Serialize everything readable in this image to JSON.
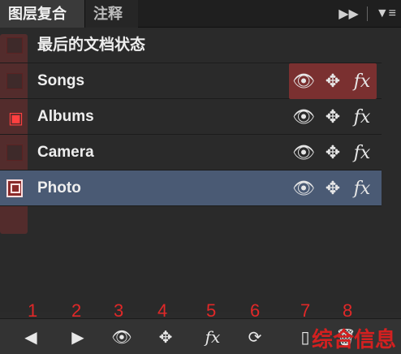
{
  "tabs": {
    "active": "图层复合",
    "second": "注释",
    "forward_icon": "double-chevron-right",
    "menu_icon": "panel-menu"
  },
  "rows": [
    {
      "label": "最后的文档状态",
      "state": "none",
      "show_icons": false
    },
    {
      "label": "Songs",
      "state": "none",
      "show_icons": true,
      "highlighted": true
    },
    {
      "label": "Albums",
      "state": "applied",
      "show_icons": true
    },
    {
      "label": "Camera",
      "state": "none",
      "show_icons": true
    },
    {
      "label": "Photo",
      "state": "current",
      "show_icons": true,
      "selected": true
    }
  ],
  "row_icons": {
    "visibility": "eye-icon",
    "position": "move-icon",
    "style": "fx"
  },
  "callout_numbers": [
    "1",
    "2",
    "3",
    "4",
    "5",
    "6",
    "7",
    "8"
  ],
  "toolbar": [
    "previous",
    "next",
    "visibility",
    "position",
    "style",
    "update",
    "new",
    "delete"
  ],
  "watermark": "综合信息",
  "colors": {
    "selected_row": "#4a5a74",
    "callout": "#e02828",
    "highlight": "#7a3030"
  }
}
